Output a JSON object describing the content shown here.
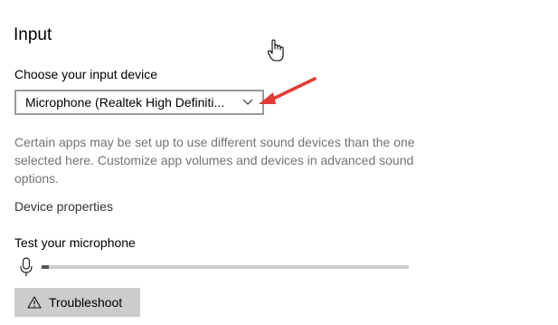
{
  "section": {
    "title": "Input"
  },
  "input_device": {
    "label": "Choose your input device",
    "selected": "Microphone (Realtek High Definiti..."
  },
  "description": "Certain apps may be set up to use different sound devices than the one selected here. Customize app volumes and devices in advanced sound options.",
  "device_properties": {
    "label": "Device properties"
  },
  "test": {
    "label": "Test your microphone",
    "level": 0.02
  },
  "troubleshoot": {
    "label": "Troubleshoot"
  },
  "icons": {
    "dropdown": "chevron-down-icon",
    "microphone": "microphone-icon",
    "warning": "warning-icon",
    "pointer": "hand-pointer-icon",
    "annotation": "red-arrow-icon"
  },
  "colors": {
    "annotation_arrow": "#e53935",
    "meter_track": "#cccccc",
    "meter_fill": "#555555",
    "button_bg": "#cccccc"
  }
}
